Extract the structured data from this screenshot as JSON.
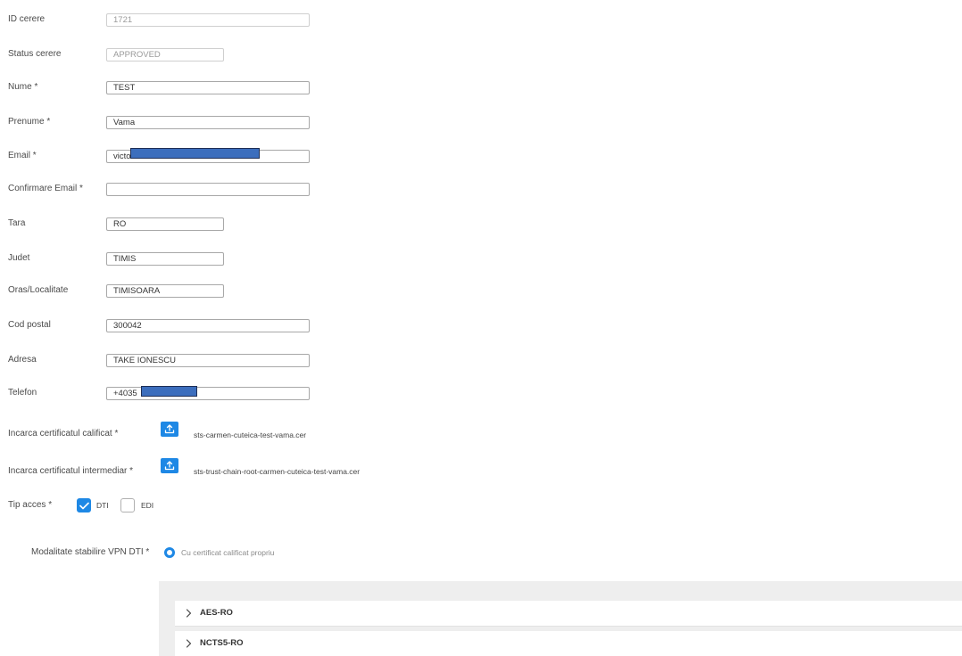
{
  "form": {
    "id_cerere": {
      "label": "ID cerere",
      "value": "1721"
    },
    "status_cerere": {
      "label": "Status cerere",
      "value": "APPROVED"
    },
    "nume": {
      "label": "Nume *",
      "value": "TEST"
    },
    "prenume": {
      "label": "Prenume *",
      "value": "Vama"
    },
    "email": {
      "label": "Email *",
      "value": "victo"
    },
    "confirmare_email": {
      "label": "Confirmare Email *",
      "value": ""
    },
    "tara": {
      "label": "Tara",
      "value": "RO"
    },
    "judet": {
      "label": "Judet",
      "value": "TIMIS"
    },
    "oras": {
      "label": "Oras/Localitate",
      "value": "TIMISOARA"
    },
    "cod_postal": {
      "label": "Cod postal",
      "value": "300042"
    },
    "adresa": {
      "label": "Adresa",
      "value": "TAKE IONESCU"
    },
    "telefon": {
      "label": "Telefon",
      "value": "+4035"
    }
  },
  "uploads": {
    "calificat": {
      "label": "Incarca certificatul calificat *",
      "filename": "sts-carmen-cuteica-test-vama.cer",
      "icon": "upload-icon"
    },
    "intermediar": {
      "label": "Incarca certificatul intermediar *",
      "filename": "sts-trust-chain-root-carmen-cuteica-test-vama.cer",
      "icon": "upload-icon"
    }
  },
  "tip_acces": {
    "label": "Tip acces *",
    "options": [
      {
        "label": "DTI",
        "checked": true
      },
      {
        "label": "EDI",
        "checked": false
      }
    ]
  },
  "vpn": {
    "label": "Modalitate stabilire VPN DTI *",
    "option_label": "Cu certificat calificat propriu"
  },
  "accordion": {
    "items": [
      {
        "title": "AES-RO",
        "icon": "chevron-right-icon"
      },
      {
        "title": "NCTS5-RO",
        "icon": "chevron-right-icon"
      }
    ]
  },
  "colors": {
    "accent": "#1e88e5",
    "redaction": "#3c6ebd",
    "panel_bg": "#eeeeee"
  }
}
